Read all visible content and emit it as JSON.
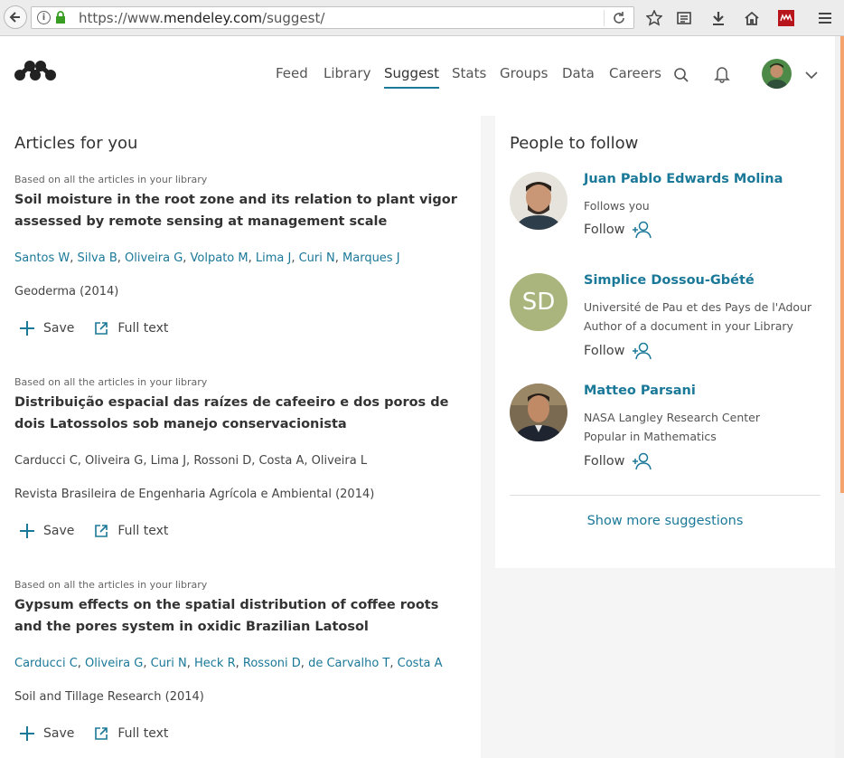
{
  "browser": {
    "url_scheme": "https://www.",
    "url_host": "mendeley.com",
    "url_path": "/suggest/"
  },
  "nav": {
    "items": [
      "Feed",
      "Library",
      "Suggest",
      "Stats",
      "Groups",
      "Data",
      "Careers"
    ],
    "active": "Suggest"
  },
  "articles_section": {
    "title": "Articles for you",
    "articles": [
      {
        "basis": "Based on all the articles in your library",
        "title": "Soil moisture in the root zone and its relation to plant vigor assessed by remote sensing at management scale",
        "authors": [
          "Santos W",
          "Silva B",
          "Oliveira G",
          "Volpato M",
          "Lima J",
          "Curi N",
          "Marques J"
        ],
        "authors_linked": true,
        "journal": "Geoderma (2014)",
        "save_label": "Save",
        "fulltext_label": "Full text"
      },
      {
        "basis": "Based on all the articles in your library",
        "title": "Distribuição espacial das raízes de cafeeiro e dos poros de dois Latossolos sob manejo conservacionista",
        "authors": [
          "Carducci C",
          "Oliveira G",
          "Lima J",
          "Rossoni D",
          "Costa A",
          "Oliveira L"
        ],
        "authors_linked": false,
        "journal": "Revista Brasileira de Engenharia Agrícola e Ambiental (2014)",
        "save_label": "Save",
        "fulltext_label": "Full text"
      },
      {
        "basis": "Based on all the articles in your library",
        "title": "Gypsum effects on the spatial distribution of coffee roots and the pores system in oxidic Brazilian Latosol",
        "authors": [
          "Carducci C",
          "Oliveira G",
          "Curi N",
          "Heck R",
          "Rossoni D",
          "de Carvalho T",
          "Costa A"
        ],
        "authors_linked": true,
        "journal": "Soil and Tillage Research (2014)",
        "save_label": "Save",
        "fulltext_label": "Full text"
      }
    ]
  },
  "people_section": {
    "title": "People to follow",
    "people": [
      {
        "name": "Juan Pablo Edwards Molina",
        "lines": [
          "Follows you"
        ],
        "follow_label": "Follow",
        "photo": "portrait"
      },
      {
        "name": "Simplice Dossou-Gbété",
        "lines": [
          "Université de Pau et des Pays de l'Adour",
          "Author of a document in your Library"
        ],
        "follow_label": "Follow",
        "initials": "SD",
        "initials_bg": "#a9b57c"
      },
      {
        "name": "Matteo Parsani",
        "lines": [
          "NASA Langley Research Center",
          "Popular in Mathematics"
        ],
        "follow_label": "Follow",
        "photo": "portrait"
      }
    ],
    "show_more": "Show more suggestions"
  },
  "colors": {
    "accent": "#1a7898",
    "orange_scroll": "#f5a36a"
  }
}
